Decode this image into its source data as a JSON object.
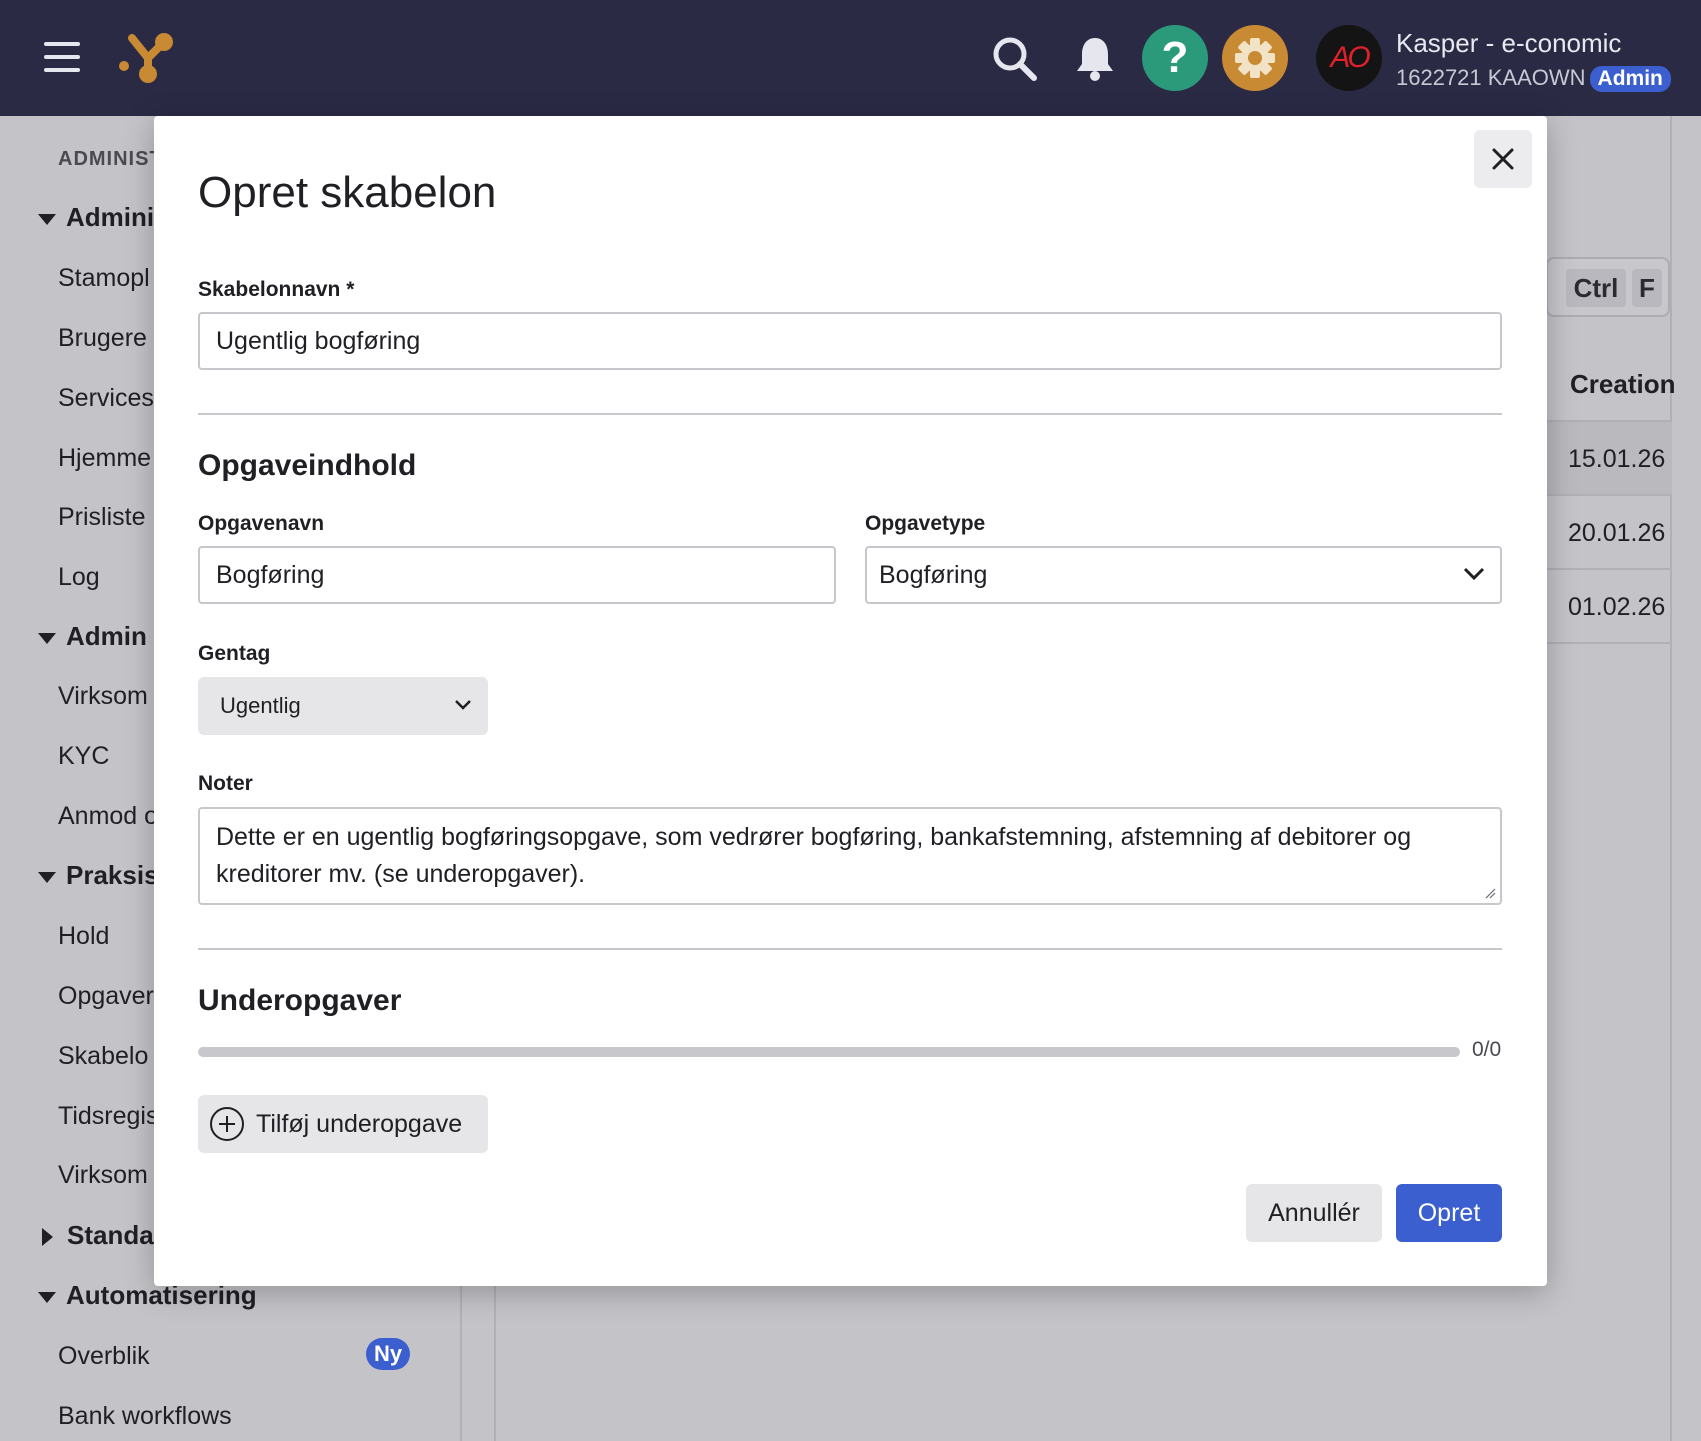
{
  "topbar": {
    "user_name": "Kasper - e-conomic",
    "user_org": "1622721 KAAOWN",
    "user_role_badge": "Admin",
    "avatar_text": "AO",
    "help_symbol": "?",
    "icons": [
      "hamburger-menu-icon",
      "app-logo",
      "search-icon",
      "bell-icon",
      "help-icon",
      "gear-icon"
    ],
    "colors": {
      "bar": "#2b2a45",
      "help": "#2a9a7a",
      "settings": "#c98a34",
      "badge": "#3b5fcf"
    }
  },
  "sidebar": {
    "caption": "ADMINIST",
    "sections": [
      {
        "label": "Adminis",
        "expanded": true,
        "items": [
          "Stamopl",
          "Brugere",
          "Services",
          "Hjemme",
          "Prisliste",
          "Log"
        ]
      },
      {
        "label": "Admin",
        "expanded": true,
        "items": [
          "Virksom",
          "KYC",
          "Anmod o"
        ]
      },
      {
        "label": "Praksis",
        "expanded": true,
        "items": [
          "Hold",
          "Opgaver",
          "Skabelo",
          "Tidsregis",
          "Virksom"
        ]
      },
      {
        "label": "Standa",
        "expanded": false,
        "items": []
      },
      {
        "label": "Automatisering",
        "expanded": true,
        "items": [
          "Overblik",
          "Bank workflows"
        ]
      }
    ],
    "new_badge": "Ny"
  },
  "background": {
    "shortcut_keys": [
      "Ctrl",
      "F"
    ],
    "table": {
      "header": "Creation",
      "rows": [
        "15.01.26",
        "20.01.26",
        "01.02.26"
      ]
    }
  },
  "modal": {
    "title": "Opret skabelon",
    "template_name_label": "Skabelonnavn *",
    "template_name_value": "Ugentlig bogføring",
    "task_content_title": "Opgaveindhold",
    "task_name_label": "Opgavenavn",
    "task_name_value": "Bogføring",
    "task_type_label": "Opgavetype",
    "task_type_value": "Bogføring",
    "repeat_label": "Gentag",
    "repeat_value": "Ugentlig",
    "notes_label": "Noter",
    "notes_value": "Dette er en ugentlig bogføringsopgave, som vedrører bogføring, bankafstemning, afstemning af debitorer og kreditorer mv. (se underopgaver).",
    "subtasks_title": "Underopgaver",
    "subtasks_progress": "0/0",
    "subtasks_progress_fraction": 0,
    "add_subtask_label": "Tilføj underopgave",
    "cancel_label": "Annullér",
    "create_label": "Opret"
  }
}
